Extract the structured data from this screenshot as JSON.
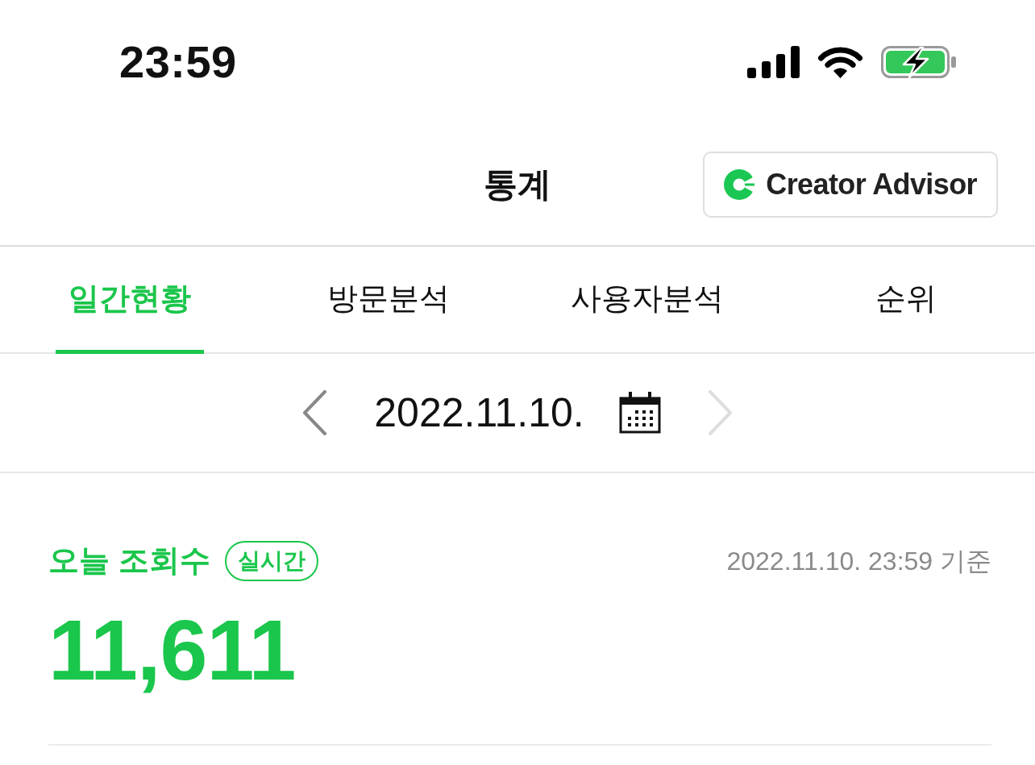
{
  "status_bar": {
    "time": "23:59",
    "charging": true
  },
  "header": {
    "title": "통계",
    "advisor_button": {
      "label": "Creator Advisor"
    }
  },
  "tabs": [
    {
      "label": "일간현황",
      "selected": true
    },
    {
      "label": "방문분석",
      "selected": false
    },
    {
      "label": "사용자분석",
      "selected": false
    },
    {
      "label": "순위",
      "selected": false
    }
  ],
  "date_nav": {
    "date": "2022.11.10.",
    "prev": {
      "disabled": false
    },
    "next": {
      "disabled": true
    }
  },
  "today_views": {
    "title": "오늘 조회수",
    "badge": "실시간",
    "as_of": "2022.11.10. 23:59 기준",
    "count": "11,611"
  }
}
